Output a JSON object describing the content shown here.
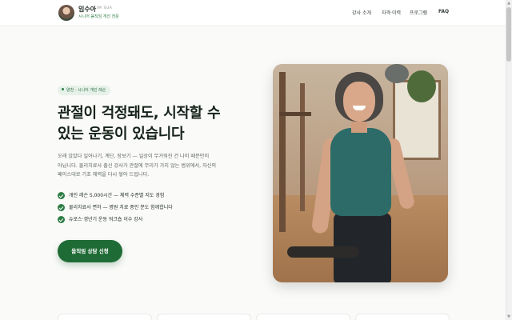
{
  "header": {
    "brand_name": "임수아",
    "brand_roman": "IM SUA",
    "brand_tagline": "시니어 움직임 개선 전문",
    "nav": [
      "강사 소개",
      "자격·이력",
      "프로그램",
      "FAQ"
    ]
  },
  "hero": {
    "badge": "양천 · 시니어 개인 레슨",
    "headline_line1": "관절이 걱정돼도, 시작할 수",
    "headline_line2": "있는 운동이 있습니다",
    "description_lines": [
      "오래 앉았다 일어나기, 계단, 장보기 — 일상이 무거워진 건 나이 때문만이",
      "아닙니다. 물리치료사 출신 강사가 관절에 무리가 가지 않는 범위에서, 자신의",
      "페이스대로 기초 체력을 다시 쌓아 드립니다."
    ],
    "checks": [
      "개인 레슨 5,000시간 — 체력 수준별 지도 경험",
      "물리치료사 면허 — 병원 치료 중인 분도 함께합니다",
      "슈로스·갱년기 운동 워크숍 이수 강사"
    ],
    "cta_label": "움직임 상담 신청"
  },
  "colors": {
    "accent": "#1f6b36",
    "accent_light": "#e6f2e9",
    "check": "#2e7d46"
  }
}
